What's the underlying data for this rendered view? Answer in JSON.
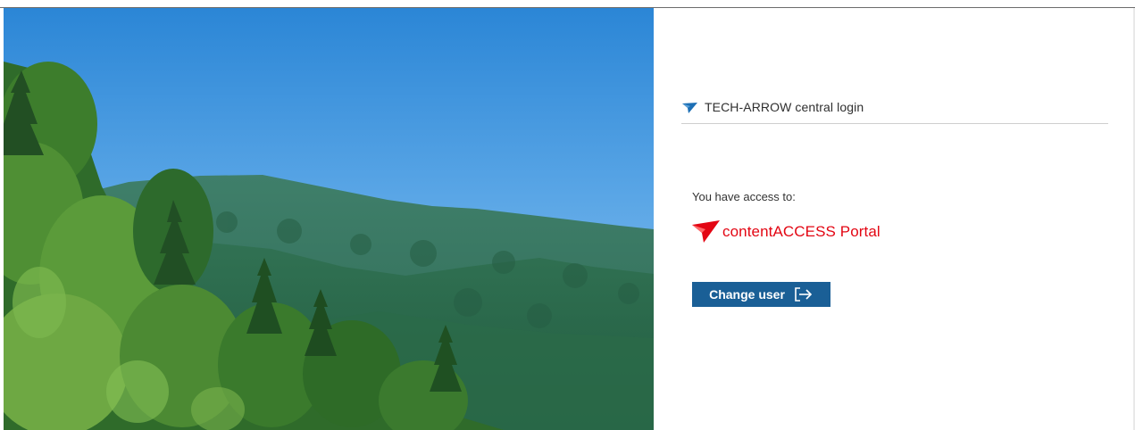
{
  "header": {
    "title": "TECH-ARROW central login",
    "logo_icon": "tech-arrow-logo-icon"
  },
  "access": {
    "label": "You have access to:",
    "apps": [
      {
        "name": "contentACCESS Portal",
        "icon": "contentaccess-logo-icon",
        "color": "#e30613"
      }
    ]
  },
  "actions": {
    "change_user_label": "Change user",
    "change_user_icon": "sign-out-icon"
  },
  "hero": {
    "description_icon": "landscape-image"
  },
  "colors": {
    "button_bg": "#1a5f96",
    "brand_red": "#e30613",
    "logo_blue": "#1c6fb5"
  }
}
